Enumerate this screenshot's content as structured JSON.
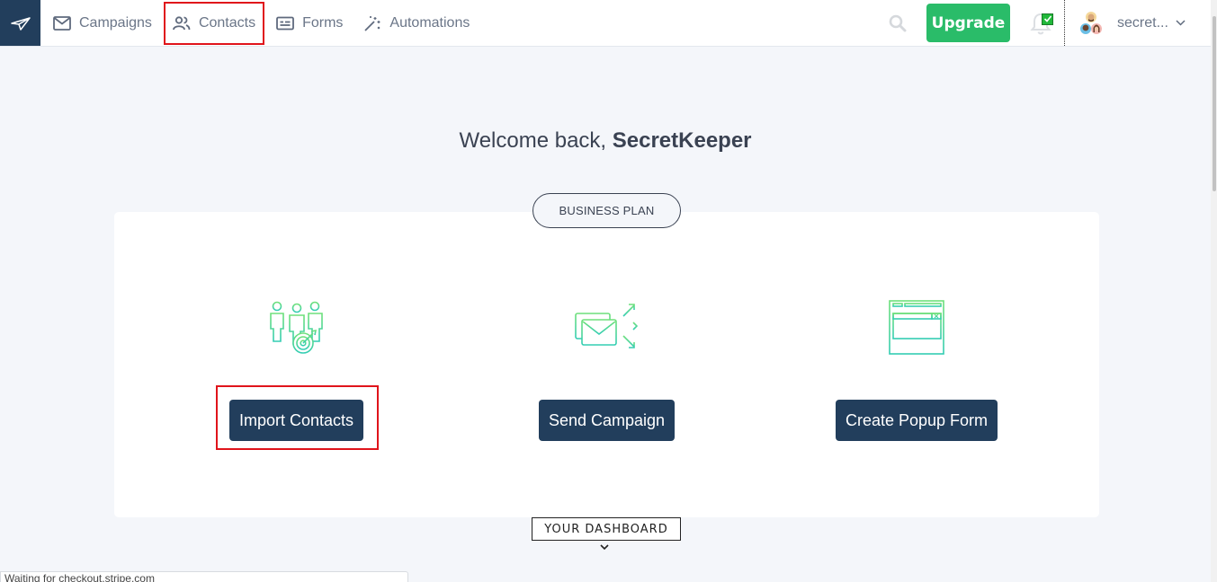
{
  "nav": {
    "items": [
      {
        "label": "Campaigns",
        "icon": "envelope-icon"
      },
      {
        "label": "Contacts",
        "icon": "users-icon",
        "highlighted": true
      },
      {
        "label": "Forms",
        "icon": "form-icon"
      },
      {
        "label": "Automations",
        "icon": "magic-wand-icon"
      }
    ],
    "upgrade_label": "Upgrade",
    "username": "secret..."
  },
  "welcome": {
    "prefix": "Welcome back, ",
    "name": "SecretKeeper"
  },
  "plan": {
    "label": "BUSINESS PLAN"
  },
  "actions": [
    {
      "label": "Import Contacts",
      "icon": "contacts-target-icon",
      "highlighted": true
    },
    {
      "label": "Send Campaign",
      "icon": "send-envelopes-icon"
    },
    {
      "label": "Create Popup Form",
      "icon": "popup-form-icon"
    }
  ],
  "dashboard": {
    "label": "YOUR DASHBOARD"
  },
  "status": {
    "text": "Waiting for checkout.stripe.com"
  },
  "colors": {
    "brand_navy": "#223e5c",
    "upgrade_green": "#2abc69",
    "highlight_red": "#e0141b",
    "icon_green": "#5cdc7c",
    "icon_teal": "#33cdb3"
  }
}
